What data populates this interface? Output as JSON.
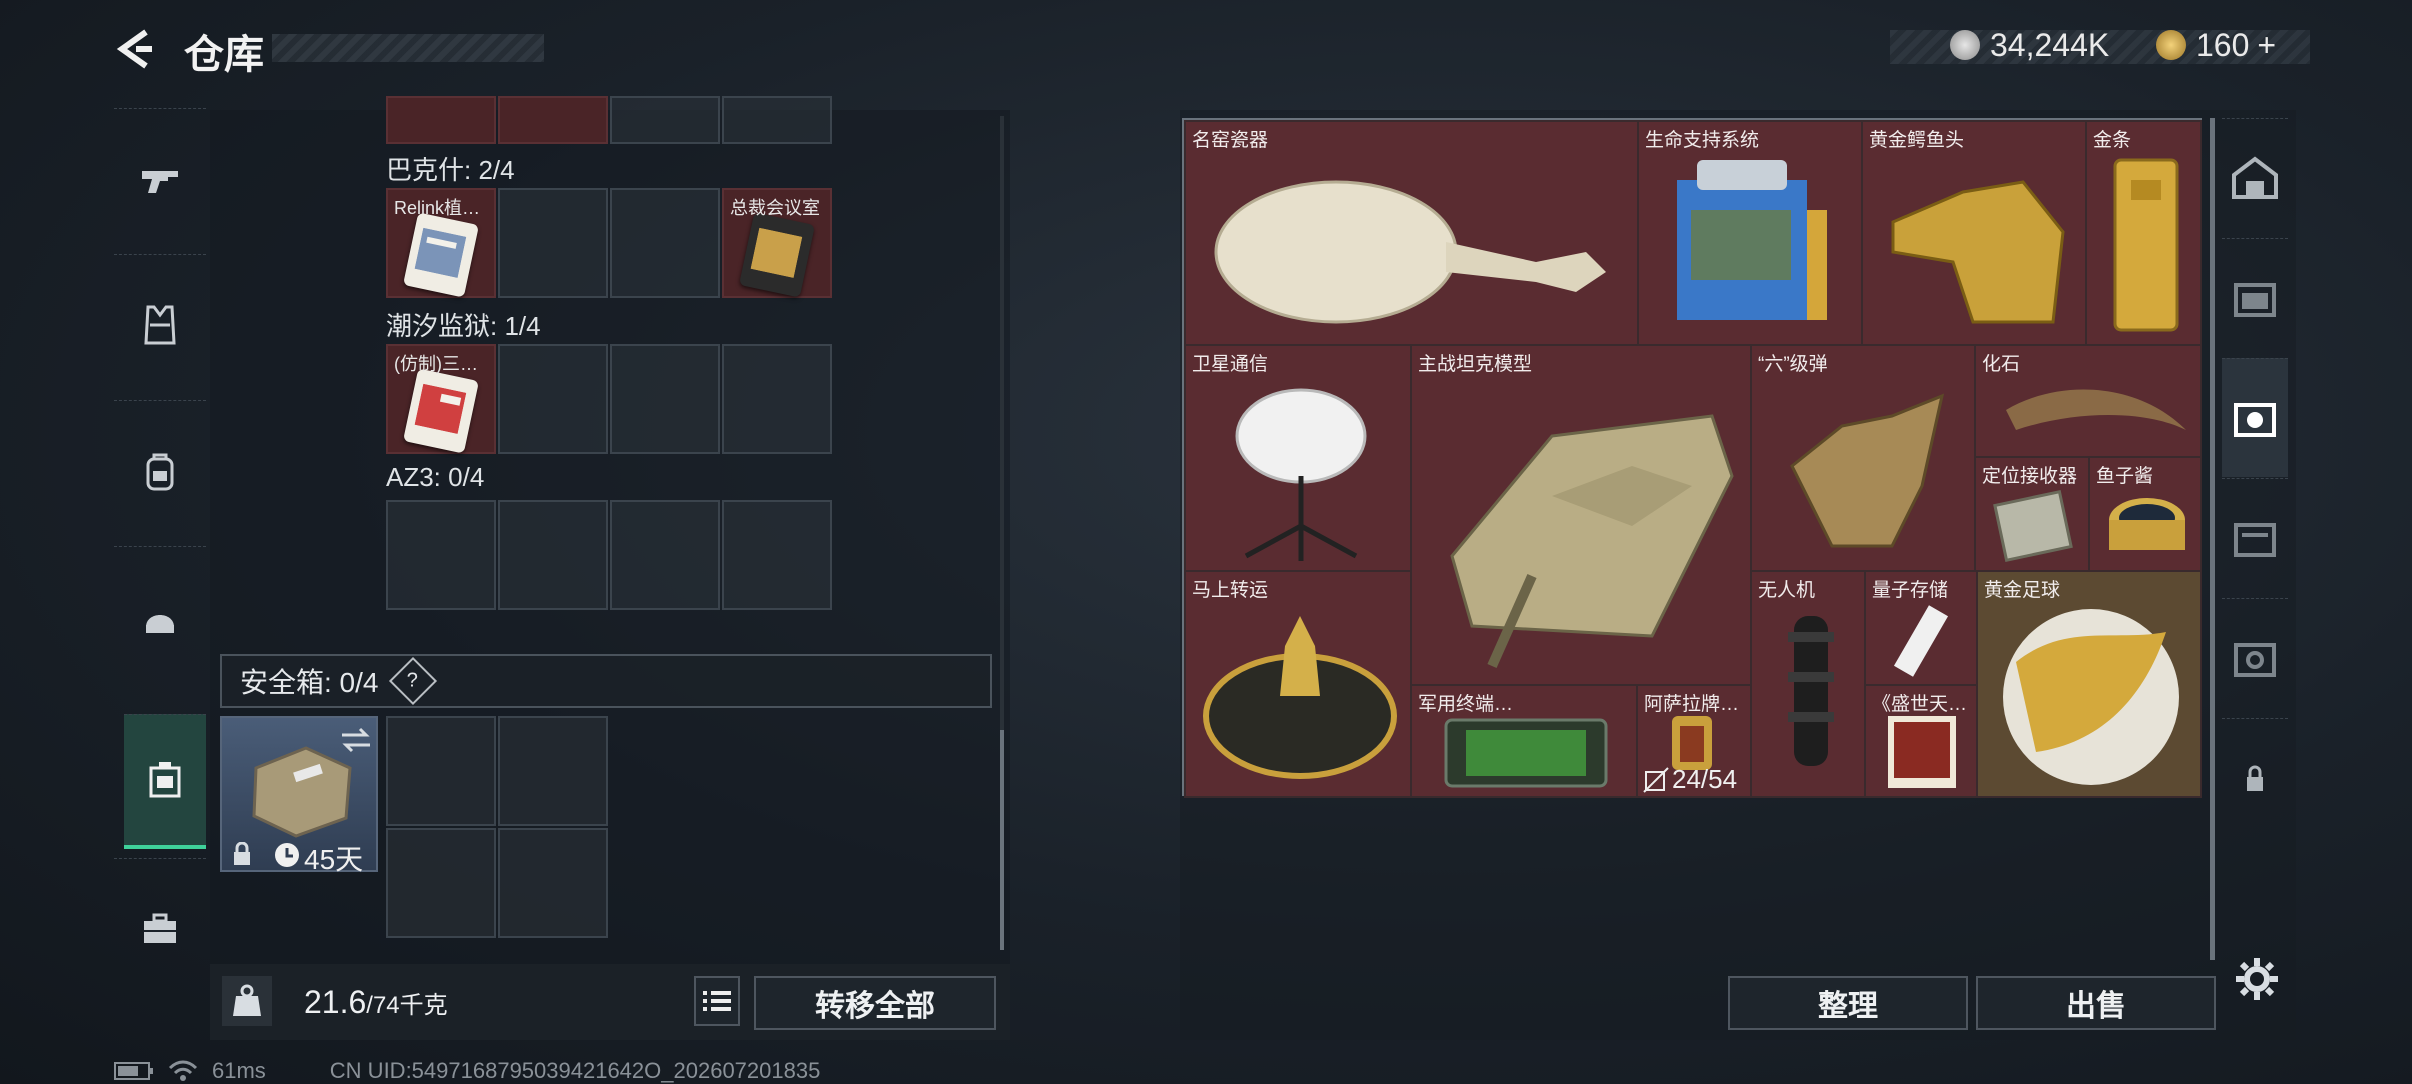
{
  "header": {
    "title": "仓库"
  },
  "currency": {
    "silver": "34,244K",
    "gold": "160",
    "plus": "+"
  },
  "left_nav": [
    {
      "icon": "gun-icon"
    },
    {
      "icon": "armor-vest-icon"
    },
    {
      "icon": "backpack-icon"
    },
    {
      "icon": "helmet-bag-icon"
    },
    {
      "icon": "safe-case-icon",
      "active": true
    },
    {
      "icon": "briefcase-icon"
    }
  ],
  "containers": [
    {
      "label": "巴克什: 2/4",
      "slots": [
        {
          "label": "Relink植…",
          "filled": true
        },
        {
          "filled": false
        },
        {
          "filled": false
        },
        {
          "label": "总裁会议室",
          "filled": true
        }
      ]
    },
    {
      "label": "潮汐监狱: 1/4",
      "slots": [
        {
          "label": "(仿制)三…",
          "filled": true
        },
        {
          "filled": false
        },
        {
          "filled": false
        },
        {
          "filled": false
        }
      ]
    },
    {
      "label": "AZ3: 0/4",
      "slots": [
        {
          "filled": false
        },
        {
          "filled": false
        },
        {
          "filled": false
        },
        {
          "filled": false
        }
      ]
    }
  ],
  "safebox": {
    "label": "安全箱: 0/4",
    "help": "?",
    "timer": "45天"
  },
  "weight": {
    "current": "21.6",
    "max": "/74千克"
  },
  "buttons": {
    "transfer_all": "转移全部",
    "organize": "整理",
    "sell": "出售"
  },
  "items": [
    {
      "label": "名窑瓷器"
    },
    {
      "label": "生命支持系统"
    },
    {
      "label": "黄金鳄鱼头"
    },
    {
      "label": "金条"
    },
    {
      "label": "卫星通信"
    },
    {
      "label": "主战坦克模型"
    },
    {
      "label": "“六”级弹"
    },
    {
      "label": "化石"
    },
    {
      "label": "定位接收器"
    },
    {
      "label": "鱼子酱"
    },
    {
      "label": "马上转运"
    },
    {
      "label": "无人机"
    },
    {
      "label": "量子存储"
    },
    {
      "label": "黄金足球"
    },
    {
      "label": "军用终端…"
    },
    {
      "label": "阿萨拉牌…",
      "count": "24/54"
    },
    {
      "label": "《盛世天…"
    }
  ],
  "status": {
    "ping": "61ms",
    "uid": "CN UID:5497168795039421642O_202607201835"
  },
  "colors": {
    "accent": "#3fd19a",
    "item_bg": "#5a2c31",
    "gold_bg": "#5c4a32"
  }
}
